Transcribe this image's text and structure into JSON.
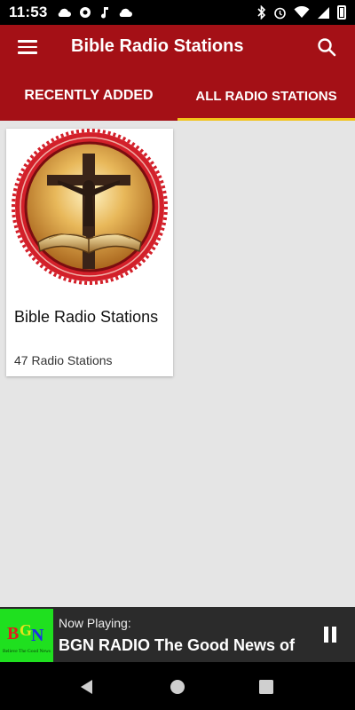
{
  "status_bar": {
    "time": "11:53",
    "notification_icons": [
      "cloud-check-icon",
      "aperture-icon",
      "music-note-icon",
      "cloud-check-icon"
    ],
    "system_icons": [
      "bluetooth-icon",
      "alarm-icon",
      "wifi-icon",
      "signal-icon",
      "battery-icon"
    ]
  },
  "app_bar": {
    "title": "Bible Radio Stations",
    "accent_color": "#a41016"
  },
  "tabs": [
    {
      "label": "RECENTLY ADDED",
      "active": false
    },
    {
      "label": "ALL RADIO STATIONS",
      "active": true
    }
  ],
  "tab_indicator_color": "#f2c21b",
  "cards": [
    {
      "title": "Bible Radio Stations",
      "subtitle": "47 Radio Stations",
      "image": "crucifix-bible-emblem"
    }
  ],
  "player": {
    "label": "Now Playing:",
    "track": "BGN RADIO The Good News of",
    "logo": "bgn-logo",
    "logo_text": "BGN",
    "logo_tagline": "Believe The Good News",
    "state": "playing"
  },
  "nav_bar": {
    "buttons": [
      "back-icon",
      "home-icon",
      "recents-icon"
    ]
  }
}
